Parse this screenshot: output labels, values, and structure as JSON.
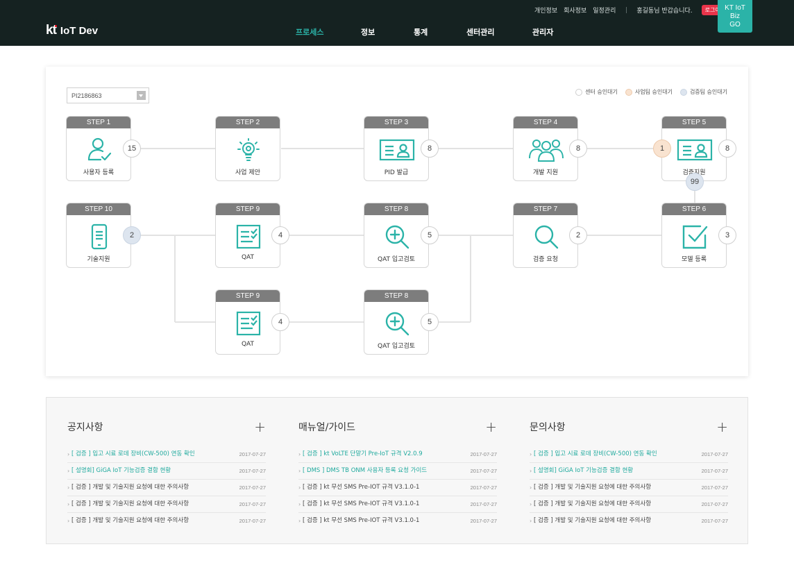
{
  "header": {
    "logo_kt": "kt",
    "logo_name": "IoT Dev",
    "util_links": [
      "개인정보",
      "회사정보",
      "일정관리"
    ],
    "greeting": "홍길동님 반갑습니다.",
    "logout_label": "로그아웃",
    "biz_button": [
      "KT IoT",
      "Biz",
      "GO"
    ],
    "nav": [
      "프로세스",
      "정보",
      "통계",
      "센터관리",
      "관리자"
    ],
    "active_nav": "프로세스",
    "colors": {
      "background": "#152221",
      "accent": "#2bb3a8",
      "logout": "#e8344a"
    }
  },
  "process": {
    "select_value": "PI2186863",
    "legend": [
      {
        "label": "센터 승인대기",
        "color": "#ffffff"
      },
      {
        "label": "사업팀 승인대기",
        "color": "#f9e3d0"
      },
      {
        "label": "검증팀 승인대기",
        "color": "#dde5ef"
      }
    ],
    "steps": [
      {
        "head": "STEP 1",
        "label": "사용자 등록",
        "icon": "user-check-icon"
      },
      {
        "head": "STEP 2",
        "label": "사업 제안",
        "icon": "lightbulb-icon"
      },
      {
        "head": "STEP 3",
        "label": "PID 발급",
        "icon": "id-card-icon"
      },
      {
        "head": "STEP 4",
        "label": "개발 지원",
        "icon": "users-icon"
      },
      {
        "head": "STEP 5",
        "label": "검증지원",
        "icon": "id-card-icon"
      },
      {
        "head": "STEP 10",
        "label": "기술지원",
        "icon": "mobile-icon"
      },
      {
        "head": "STEP 9",
        "label": "QAT",
        "icon": "checklist-icon"
      },
      {
        "head": "STEP 8",
        "label": "QAT 입고검토",
        "icon": "zoom-in-icon"
      },
      {
        "head": "STEP 7",
        "label": "검증 요청",
        "icon": "search-icon"
      },
      {
        "head": "STEP 6",
        "label": "모델 등록",
        "icon": "checkbox-icon"
      },
      {
        "head": "STEP 9",
        "label": "QAT",
        "icon": "checklist-icon"
      },
      {
        "head": "STEP 8",
        "label": "QAT 입고검토",
        "icon": "zoom-in-icon"
      }
    ],
    "badges": [
      {
        "value": "15",
        "status": "center"
      },
      {
        "value": "8",
        "status": "center"
      },
      {
        "value": "8",
        "status": "center"
      },
      {
        "value": "1",
        "status": "business"
      },
      {
        "value": "8",
        "status": "center"
      },
      {
        "value": "99",
        "status": "verify"
      },
      {
        "value": "2",
        "status": "verify"
      },
      {
        "value": "4",
        "status": "center"
      },
      {
        "value": "5",
        "status": "center"
      },
      {
        "value": "2",
        "status": "center"
      },
      {
        "value": "3",
        "status": "center"
      },
      {
        "value": "4",
        "status": "center"
      },
      {
        "value": "5",
        "status": "center"
      }
    ]
  },
  "boards": [
    {
      "title": "공지사항",
      "items": [
        {
          "text": "[ 검증 ] 입고 시료 로데 장비(CW-500) 연동 확인",
          "date": "2017-07-27",
          "highlight": true
        },
        {
          "text": "[ 설명회] GiGA IoT 기능검증 결함 현황",
          "date": "2017-07-27",
          "highlight": true
        },
        {
          "text": "[ 검증 ] 개발 및 기술지원 요청에 대한 주의사항",
          "date": "2017-07-27",
          "highlight": false
        },
        {
          "text": "[ 검증 ] 개발 및 기술지원 요청에 대한 주의사항",
          "date": "2017-07-27",
          "highlight": false
        },
        {
          "text": "[ 검증 ] 개발 및 기술지원 요청에 대한 주의사항",
          "date": "2017-07-27",
          "highlight": false
        }
      ]
    },
    {
      "title": "매뉴얼/가이드",
      "items": [
        {
          "text": "[ 검증 ] kt VoLTE 단말기 Pre-IoT 규격 V2.0.9",
          "date": "2017-07-27",
          "highlight": true
        },
        {
          "text": "[ DMS ] DMS TB ONM 사용자 등록 요청 가이드",
          "date": "2017-07-27",
          "highlight": true
        },
        {
          "text": "[ 검증 ] kt 무선 SMS Pre-IOT 규격 V3.1.0-1",
          "date": "2017-07-27",
          "highlight": false
        },
        {
          "text": "[ 검증 ] kt 무선 SMS Pre-IOT 규격 V3.1.0-1",
          "date": "2017-07-27",
          "highlight": false
        },
        {
          "text": "[ 검증 ] kt 무선 SMS Pre-IOT 규격 V3.1.0-1",
          "date": "2017-07-27",
          "highlight": false
        }
      ]
    },
    {
      "title": "문의사항",
      "items": [
        {
          "text": "[ 검증 ] 입고 시료 로데 장비(CW-500) 연동 확인",
          "date": "2017-07-27",
          "highlight": true
        },
        {
          "text": "[ 설명회] GiGA IoT 기능검증 결함 현황",
          "date": "2017-07-27",
          "highlight": true
        },
        {
          "text": "[ 검증 ] 개발 및 기술지원 요청에 대한 주의사항",
          "date": "2017-07-27",
          "highlight": false
        },
        {
          "text": "[ 검증 ] 개발 및 기술지원 요청에 대한 주의사항",
          "date": "2017-07-27",
          "highlight": false
        },
        {
          "text": "[ 검증 ] 개발 및 기술지원 요청에 대한 주의사항",
          "date": "2017-07-27",
          "highlight": false
        }
      ]
    }
  ]
}
